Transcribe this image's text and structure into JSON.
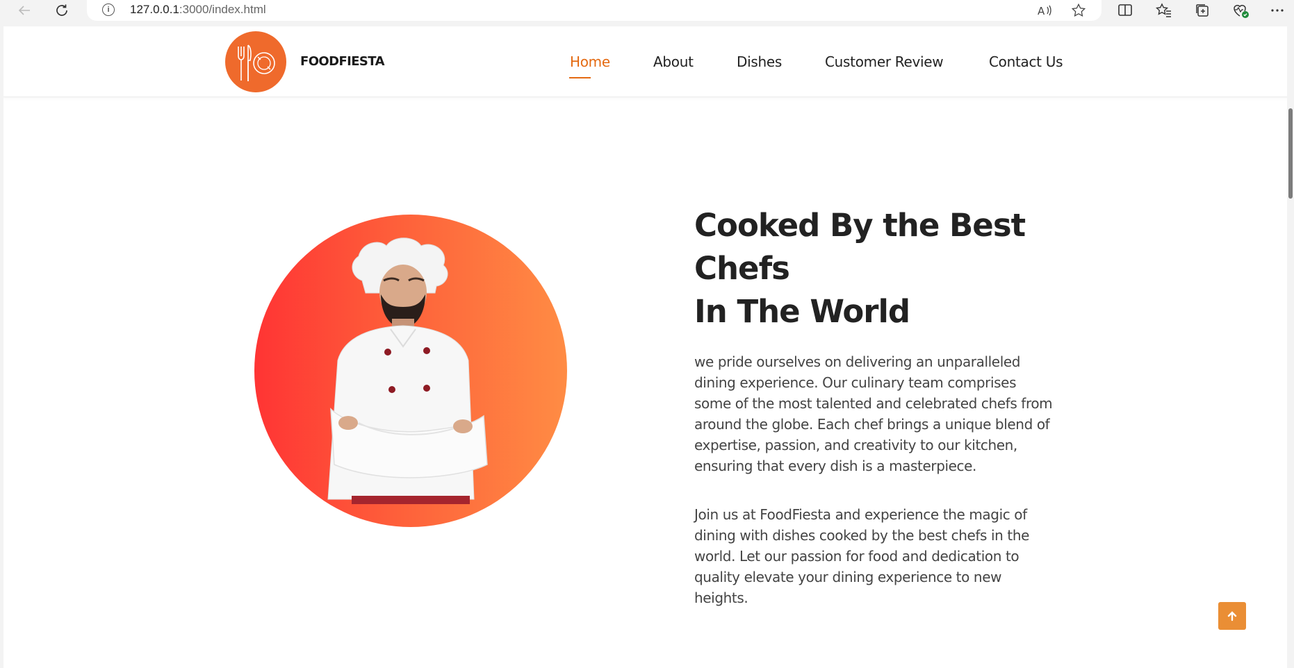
{
  "browser": {
    "url_host": "127.0.0.1",
    "url_rest": ":3000/index.html"
  },
  "site": {
    "brand": "FOODFIESTA",
    "accent_color": "#e46a12",
    "nav": [
      {
        "label": "Home",
        "active": true
      },
      {
        "label": "About"
      },
      {
        "label": "Dishes"
      },
      {
        "label": "Customer Review"
      },
      {
        "label": "Contact Us"
      }
    ]
  },
  "hero": {
    "headline_line1": "Cooked By the Best",
    "headline_line2": "Chefs",
    "headline_line3": "In The World",
    "paragraph1": "we pride ourselves on delivering an unparalleled dining experience. Our culinary team comprises some of the most talented and celebrated chefs from around the globe. Each chef brings a unique blend of expertise, passion, and creativity to our kitchen, ensuring that every dish is a masterpiece.",
    "paragraph2": "Join us at FoodFiesta and experience the magic of dining with dishes cooked by the best chefs in the world. Let our passion for food and dedication to quality elevate your dining experience to new heights."
  },
  "icons": {
    "back": "back-arrow-icon",
    "reload": "reload-icon",
    "info": "info-icon",
    "read_aloud": "read-aloud-icon",
    "favorite": "star-icon",
    "split": "split-screen-icon",
    "favorites": "favorites-list-icon",
    "collections": "collections-icon",
    "health": "browser-essentials-icon",
    "more": "more-icon",
    "scroll_top": "arrow-up-icon"
  }
}
